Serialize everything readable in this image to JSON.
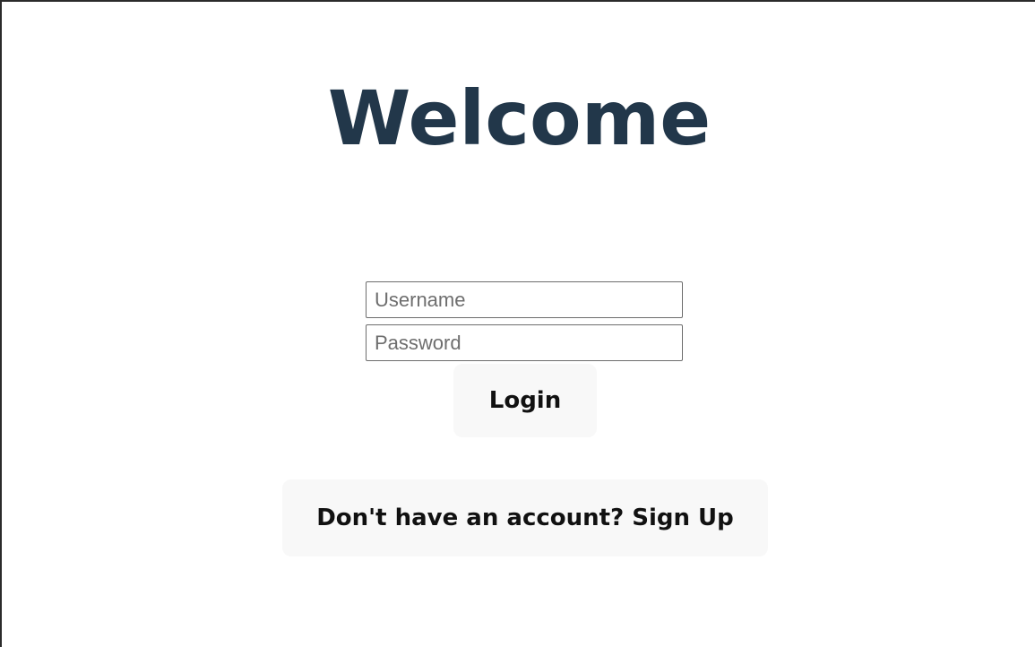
{
  "page": {
    "title": "Welcome"
  },
  "form": {
    "username_placeholder": "Username",
    "username_value": "",
    "password_placeholder": "Password",
    "password_value": "",
    "login_label": "Login",
    "signup_label": "Don't have an account? Sign Up"
  },
  "colors": {
    "title": "#22374a",
    "button_bg": "#f8f8f8"
  }
}
